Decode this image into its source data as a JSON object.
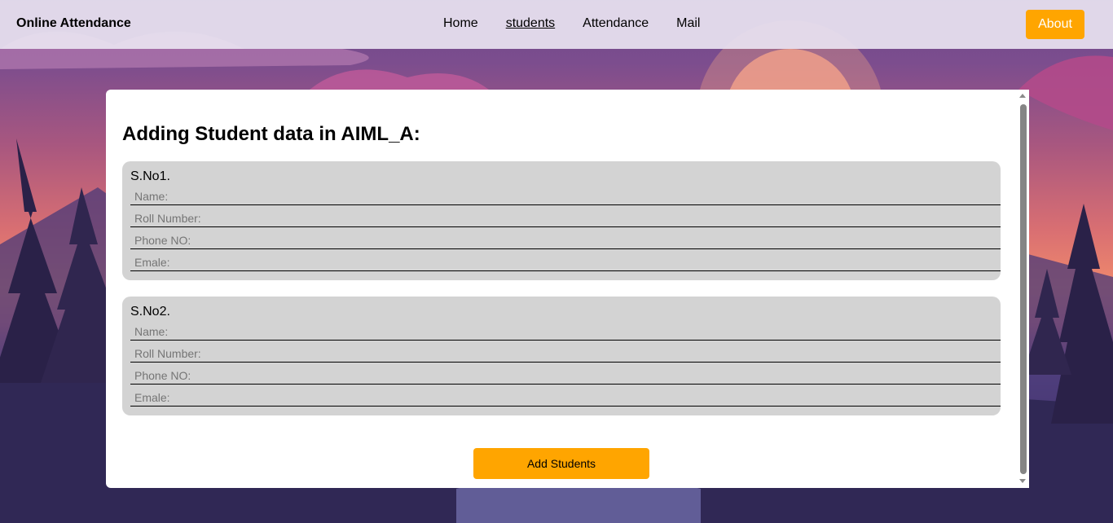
{
  "navbar": {
    "brand": "Online Attendance",
    "links": [
      "Home",
      "students",
      "Attendance",
      "Mail"
    ],
    "active_link": "students",
    "about_label": "About"
  },
  "main": {
    "title": "Adding Student data in AIML_A:",
    "students": [
      {
        "label": "S.No1.",
        "fields": [
          {
            "placeholder": "Name:",
            "value": ""
          },
          {
            "placeholder": "Roll Number:",
            "value": ""
          },
          {
            "placeholder": "Phone NO:",
            "value": ""
          },
          {
            "placeholder": "Emale:",
            "value": ""
          }
        ]
      },
      {
        "label": "S.No2.",
        "fields": [
          {
            "placeholder": "Name:",
            "value": ""
          },
          {
            "placeholder": "Roll Number:",
            "value": ""
          },
          {
            "placeholder": "Phone NO:",
            "value": ""
          },
          {
            "placeholder": "Emale:",
            "value": ""
          }
        ]
      }
    ],
    "add_button_label": "Add Students"
  },
  "colors": {
    "accent": "#ffa500",
    "card_bg": "#d3d3d3",
    "navbar_bg": "#e8e2f0",
    "panel_bg": "#ffffff"
  },
  "icons": {
    "scroll_up": "scroll-up-arrow-icon",
    "scroll_down": "scroll-down-arrow-icon"
  }
}
